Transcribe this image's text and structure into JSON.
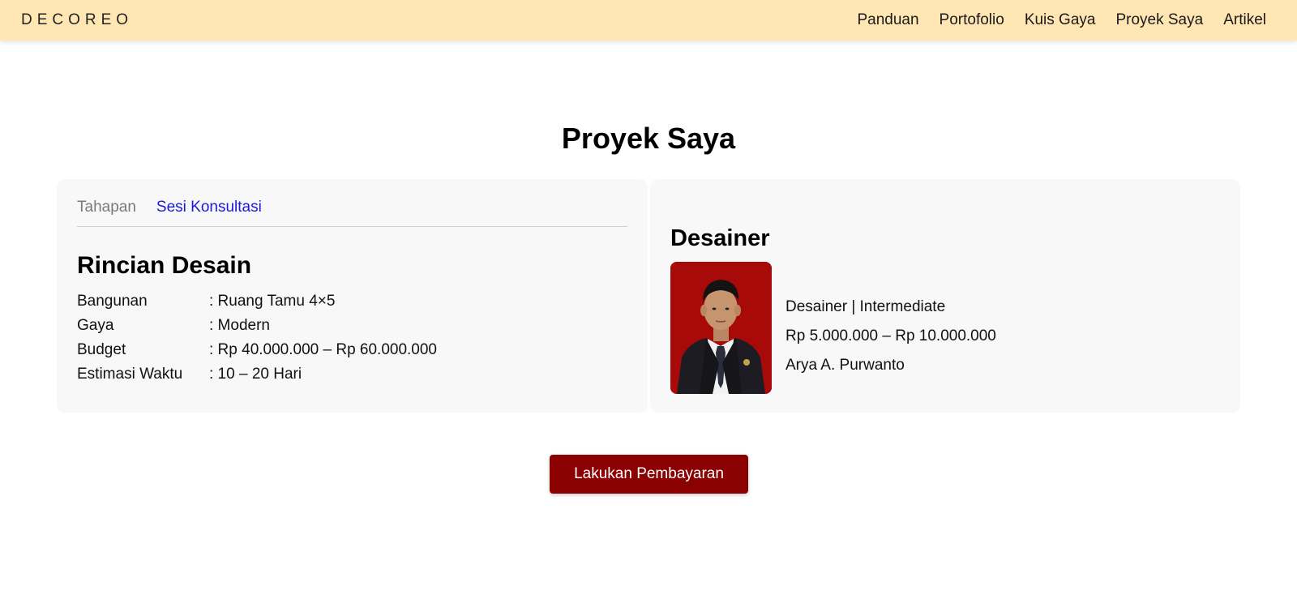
{
  "navbar": {
    "brand": "DECOREO",
    "links": [
      "Panduan",
      "Portofolio",
      "Kuis Gaya",
      "Proyek Saya",
      "Artikel"
    ]
  },
  "page": {
    "title": "Proyek Saya"
  },
  "project": {
    "tabs": [
      {
        "label": "Tahapan",
        "active": false
      },
      {
        "label": "Sesi Konsultasi",
        "active": true
      }
    ],
    "section_title": "Rincian Desain",
    "details": [
      {
        "label": "Bangunan",
        "value": ": Ruang Tamu 4×5"
      },
      {
        "label": "Gaya",
        "value": ": Modern"
      },
      {
        "label": "Budget",
        "value": ": Rp 40.000.000 – Rp 60.000.000"
      },
      {
        "label": "Estimasi Waktu",
        "value": ": 10 – 20 Hari"
      }
    ]
  },
  "designer": {
    "title": "Desainer",
    "level": "Desainer | Intermediate",
    "price_range": "Rp 5.000.000 – Rp 10.000.000",
    "name": "Arya A. Purwanto"
  },
  "actions": {
    "pay_label": "Lakukan Pembayaran"
  },
  "colors": {
    "navbar_bg": "#ffe6b3",
    "active_tab": "#1a1adb",
    "pay_button": "#8b0000",
    "photo_bg": "#a80a0a"
  }
}
